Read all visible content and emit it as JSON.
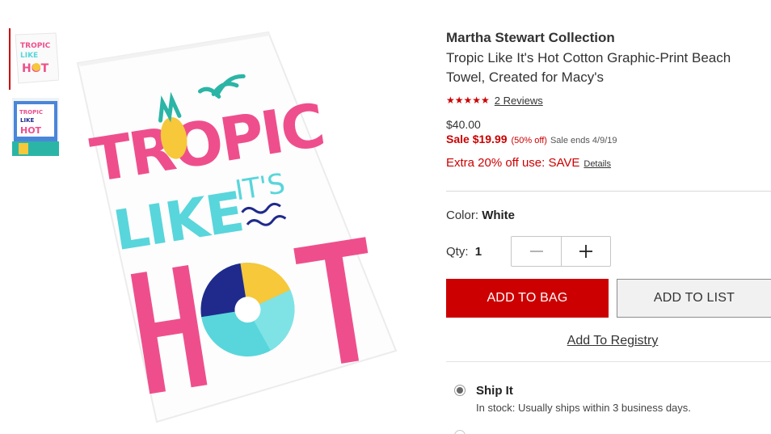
{
  "thumbnails": [
    {
      "name": "towel-front-thumb",
      "active": true
    },
    {
      "name": "towel-lifestyle-thumb",
      "active": false
    }
  ],
  "main_image": {
    "art_words": [
      "TROPIC",
      "LIKE",
      "IT'S",
      "HOT"
    ]
  },
  "product": {
    "brand": "Martha Stewart Collection",
    "title": "Tropic Like It's Hot Cotton Graphic-Print Beach Towel, Created for Macy's",
    "stars": "★★★★★",
    "reviews": "2 Reviews",
    "original_price": "$40.00",
    "sale_price": "Sale $19.99",
    "percent_off": "(50% off)",
    "sale_ends": "Sale ends 4/9/19",
    "promo": "Extra 20% off use: SAVE",
    "details_link": "Details"
  },
  "color": {
    "label": "Color:",
    "value": "White"
  },
  "quantity": {
    "label": "Qty:",
    "value": "1"
  },
  "buttons": {
    "add_to_bag": "ADD TO BAG",
    "add_to_list": "ADD TO LIST",
    "add_to_registry": "Add To Registry"
  },
  "shipping": {
    "title": "Ship It",
    "subtitle": "In stock: Usually ships within 3 business days."
  },
  "colors": {
    "brand_red": "#cc0000",
    "pink": "#ee4f8c",
    "teal": "#58d6db",
    "yellow": "#f6c83a",
    "navy": "#1f2a8c"
  }
}
